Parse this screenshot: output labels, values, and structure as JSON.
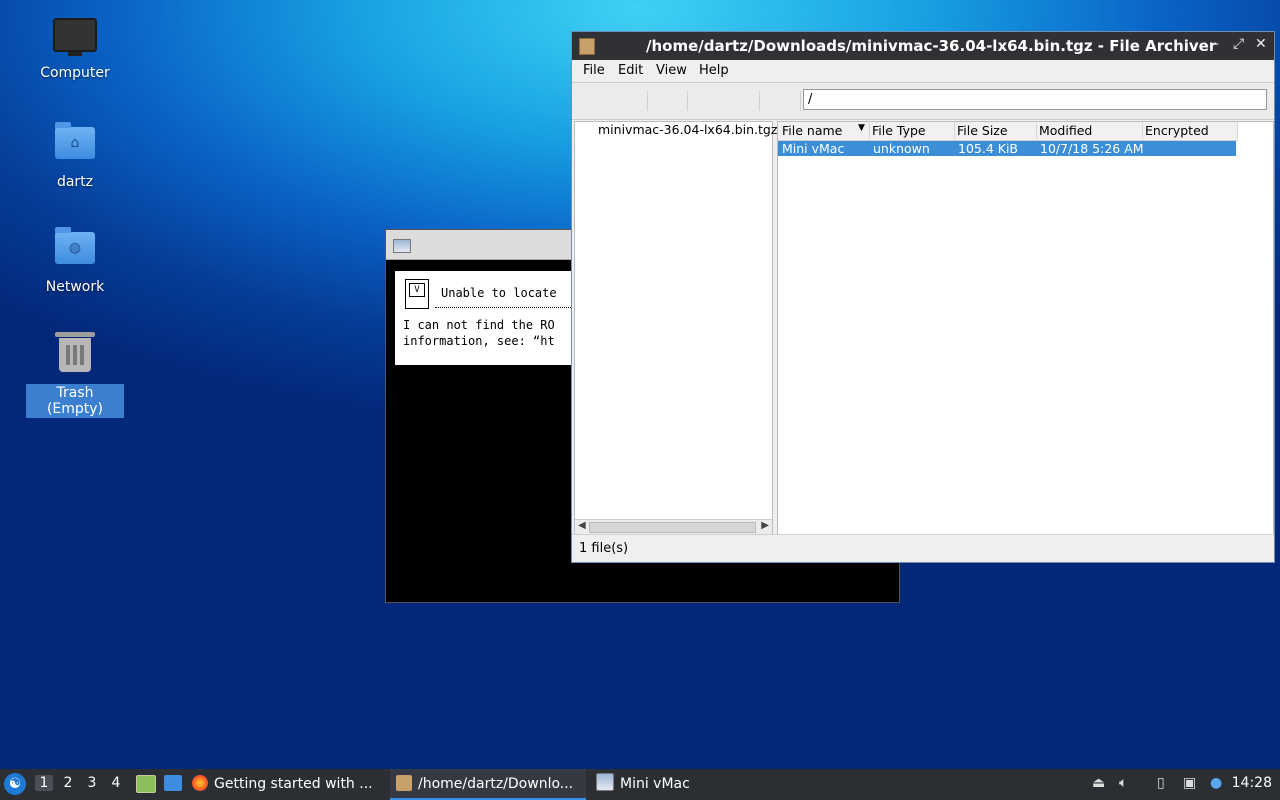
{
  "desktop": {
    "icons": [
      {
        "label": "Computer"
      },
      {
        "label": "dartz"
      },
      {
        "label": "Network"
      },
      {
        "label": "Trash (Empty)"
      }
    ]
  },
  "vmac_window": {
    "dialog_title": "Unable to locate",
    "dialog_line1": "I can not find the RO",
    "dialog_line2": "information, see: “ht"
  },
  "archiver": {
    "title": "/home/dartz/Downloads/minivmac-36.04-lx64.bin.tgz - File Archiver",
    "window_buttons": {
      "minimize": "–",
      "maximize": "⤢",
      "close": "✕"
    },
    "menu": {
      "file": "File",
      "edit": "Edit",
      "view": "View",
      "help": "Help"
    },
    "location": "/",
    "tree_item": "minivmac-36.04-lx64.bin.tgz",
    "columns": [
      "File name",
      "File Type",
      "File Size",
      "Modified",
      "Encrypted"
    ],
    "rows": [
      {
        "name": "Mini vMac",
        "type": "unknown",
        "size": "105.4 KiB",
        "modified": "10/7/18 5:26 AM",
        "encrypted": ""
      }
    ],
    "status": "1 file(s)"
  },
  "taskbar": {
    "workspaces": [
      "1",
      "2",
      "3",
      "4"
    ],
    "tasks": [
      {
        "label": "Getting started with ..."
      },
      {
        "label": "/home/dartz/Downlo..."
      },
      {
        "label": "Mini vMac"
      }
    ],
    "clock": "14:28"
  },
  "colors": {
    "selection": "#3c8fd6",
    "taskbar": "#2b2e33",
    "titlebar": "#2f3135"
  }
}
